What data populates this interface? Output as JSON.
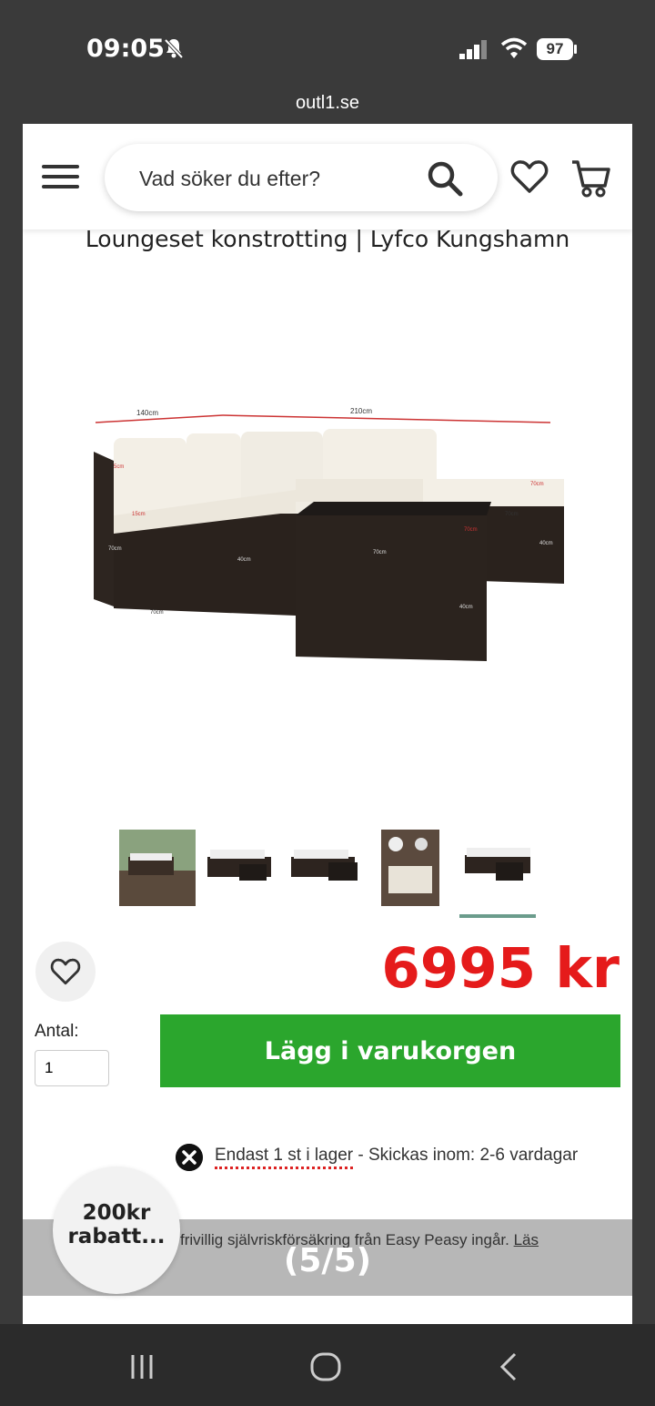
{
  "status_bar": {
    "time": "09:05",
    "battery": "97"
  },
  "browser": {
    "url": "outl1.se"
  },
  "header": {
    "search_placeholder": "Vad söker du efter?"
  },
  "product": {
    "title": "Loungeset konstrotting | Lyfco Kungshamn",
    "price": "6995 kr",
    "quantity_label": "Antal:",
    "quantity_value": "1",
    "add_to_cart_label": "Lägg i varukorgen",
    "stock_status": "Endast 1 st i lager",
    "shipping_info": " - Skickas inom: 2-6 vardagar",
    "insurance_text": "frivillig självriskförsäkring från Easy Peasy ingår.",
    "insurance_link": "Läs",
    "image_labels": [
      "140cm",
      "210cm",
      "5cm",
      "15cm",
      "70cm",
      "70cm",
      "40cm",
      "70cm",
      "70cm",
      "70cm",
      "70cm",
      "40cm",
      "40cm"
    ]
  },
  "gallery": {
    "counter": "(5/5)",
    "thumbnail_count": 5,
    "active_index": 4
  },
  "discount": {
    "line1": "200kr",
    "line2": "rabatt..."
  },
  "colors": {
    "price": "#e51b1b",
    "add_to_cart": "#2ba62d",
    "stock_underline": "#d22222",
    "thumb_active": "#6b9c8c"
  }
}
